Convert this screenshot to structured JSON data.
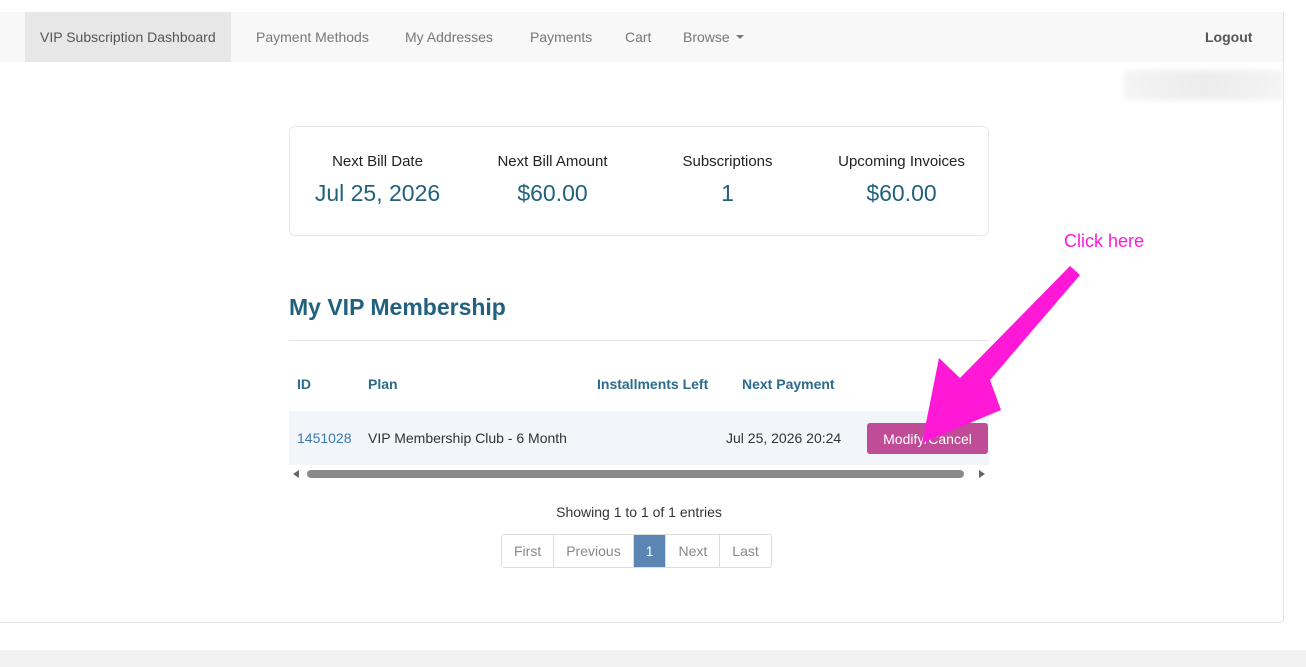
{
  "navbar": {
    "items": [
      {
        "label": "VIP Subscription Dashboard",
        "active": true
      },
      {
        "label": "Payment Methods"
      },
      {
        "label": "My Addresses"
      },
      {
        "label": "Payments"
      },
      {
        "label": "Cart"
      },
      {
        "label": "Browse"
      }
    ],
    "logout_label": "Logout"
  },
  "stats": [
    {
      "label": "Next Bill Date",
      "value": "Jul 25, 2026"
    },
    {
      "label": "Next Bill Amount",
      "value": "$60.00"
    },
    {
      "label": "Subscriptions",
      "value": "1"
    },
    {
      "label": "Upcoming Invoices",
      "value": "$60.00"
    }
  ],
  "membership": {
    "title": "My VIP Membership",
    "columns": [
      "ID",
      "Plan",
      "Installments Left",
      "Next Payment"
    ],
    "rows": [
      {
        "id": "1451028",
        "plan": "VIP Membership Club - 6 Month",
        "installments_left": "",
        "next_payment": "Jul 25, 2026 20:24",
        "action_label": "Modify/Cancel"
      }
    ],
    "info": "Showing 1 to 1 of 1 entries",
    "pagination": [
      "First",
      "Previous",
      "1",
      "Next",
      "Last"
    ],
    "current_page": "1"
  },
  "annotation": {
    "text": "Click here",
    "color": "#ff19d7"
  },
  "colors": {
    "accent": "#22617e",
    "button": "#c04c97",
    "pagination_active": "#5b86b3"
  }
}
